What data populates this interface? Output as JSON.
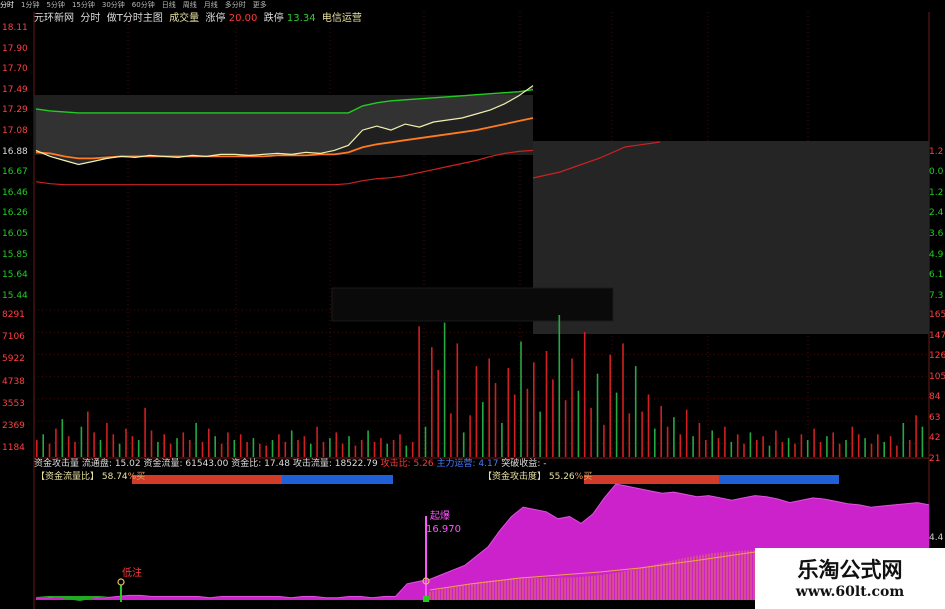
{
  "toolbar": {
    "tabs": [
      "分时",
      "1分钟",
      "5分钟",
      "15分钟",
      "30分钟",
      "60分钟",
      "日线",
      "周线",
      "月线",
      "多分时",
      "更多"
    ]
  },
  "header": {
    "stock_name": "元环新网",
    "view_label": "分时",
    "formula_label": "做T分时主图",
    "volume_label": "成交量",
    "limit_up_label": "涨停",
    "limit_up_value": "20.00",
    "limit_down_label": "跌停",
    "limit_down_value": "13.34",
    "sector_label": "电信运营"
  },
  "price_axis": {
    "left": [
      "18.11",
      "17.90",
      "17.70",
      "17.49",
      "17.29",
      "17.08",
      "16.88",
      "16.67",
      "16.46",
      "16.26",
      "16.05",
      "15.85",
      "15.64",
      "15.44"
    ],
    "right": [
      "",
      "",
      "",
      "",
      "",
      "",
      "1.2",
      "0.0",
      "1.2",
      "2.4",
      "3.6",
      "4.9",
      "6.1",
      "7.3"
    ]
  },
  "volume_axis": {
    "left": [
      "8291",
      "7106",
      "5922",
      "4738",
      "3553",
      "2369",
      "1184"
    ],
    "right": [
      "165",
      "147",
      "126",
      "105",
      "84",
      "63",
      "42",
      "21"
    ]
  },
  "indicator": {
    "name": "资金攻击量",
    "flow_label": "流通盘",
    "flow_value": "15.02",
    "fund_flow_label": "资金流量",
    "fund_flow_value": "61543.00",
    "fund_ratio_label": "资金比",
    "fund_ratio_value": "17.48",
    "attack_flow_label": "攻击流量",
    "attack_flow_value": "18522.79",
    "attack_ratio_label": "攻击比",
    "attack_ratio_value": "5.26",
    "extra_label": "主力运营",
    "extra_value": "4.17",
    "breakout_label": "突破收益",
    "breakout_value": "-",
    "ratio_bar_label": "【资金流量比】",
    "ratio_bar_value": "58.74",
    "ratio_bar_side": "%买",
    "attack_bar_label": "【资金攻击度】",
    "attack_bar_value": "55.26",
    "attack_bar_side": "%买",
    "sig1_label": "低注",
    "sig2_label": "起爆",
    "sig2_value": "16.970",
    "right_tick": "4.4"
  },
  "watermark": {
    "title": "乐淘公式网",
    "url": "www.60lt.com"
  },
  "colors": {
    "price_line": "#f0f0b0",
    "upper_band": "#22cc22",
    "lower_band": "#cc2222",
    "avg_line": "#ff7a20",
    "magenta": "#cc22cc",
    "bar_red": "#d23a2a",
    "bar_blue": "#1f5fd8"
  },
  "chart_data": [
    {
      "type": "line",
      "series": [
        {
          "values": [
            16.9,
            16.84,
            16.8,
            16.76,
            16.79,
            16.82,
            16.84,
            16.83,
            16.85,
            16.84,
            16.83,
            16.85,
            16.84,
            16.86,
            16.86,
            16.85,
            16.86,
            16.87,
            16.86,
            16.88,
            16.87,
            16.9,
            16.95,
            17.1,
            17.14,
            17.1,
            17.16,
            17.13,
            17.18,
            17.2,
            17.22,
            17.26,
            17.3,
            17.36,
            17.44,
            17.54
          ]
        },
        {
          "values": [
            17.31,
            17.29,
            17.28,
            17.27,
            17.27,
            17.27,
            17.27,
            17.27,
            17.27,
            17.27,
            17.27,
            17.27,
            17.27,
            17.27,
            17.27,
            17.27,
            17.27,
            17.27,
            17.27,
            17.27,
            17.27,
            17.27,
            17.27,
            17.34,
            17.37,
            17.39,
            17.4,
            17.41,
            17.42,
            17.43,
            17.44,
            17.45,
            17.46,
            17.47,
            17.48,
            17.5
          ]
        },
        {
          "values": [
            16.59,
            16.57,
            16.56,
            16.56,
            16.56,
            16.56,
            16.56,
            16.56,
            16.56,
            16.56,
            16.56,
            16.56,
            16.56,
            16.56,
            16.56,
            16.56,
            16.56,
            16.56,
            16.56,
            16.56,
            16.56,
            16.56,
            16.57,
            16.6,
            16.62,
            16.63,
            16.65,
            16.68,
            16.71,
            16.74,
            16.77,
            16.8,
            16.84,
            16.87,
            16.89,
            16.9
          ]
        },
        {
          "values": [
            16.88,
            16.87,
            16.84,
            16.82,
            16.82,
            16.83,
            16.84,
            16.84,
            16.84,
            16.84,
            16.84,
            16.84,
            16.84,
            16.84,
            16.84,
            16.84,
            16.84,
            16.85,
            16.85,
            16.85,
            16.86,
            16.86,
            16.88,
            16.93,
            16.96,
            16.98,
            17.0,
            17.02,
            17.04,
            17.06,
            17.08,
            17.1,
            17.13,
            17.16,
            17.19,
            17.22
          ]
        }
      ],
      "ylim": [
        15.44,
        18.11
      ]
    },
    {
      "type": "bar",
      "values": [
        900,
        1200,
        700,
        1500,
        2000,
        1100,
        800,
        1600,
        2400,
        1300,
        900,
        1800,
        1200,
        700,
        1500,
        1100,
        900,
        2600,
        1400,
        800,
        1200,
        700,
        1000,
        1300,
        900,
        1800,
        800,
        1500,
        1100,
        700,
        1300,
        900,
        1200,
        800,
        1000,
        700,
        600,
        900,
        1200,
        800,
        1400,
        900,
        1100,
        700,
        1600,
        800,
        1000,
        1300,
        700,
        1100,
        600,
        900,
        1400,
        800,
        1000,
        700,
        900,
        1200,
        600,
        800,
        6900,
        1600,
        5800,
        4600,
        7100,
        2300,
        6000,
        1300,
        2200,
        4800,
        2900,
        5200,
        3900,
        1800,
        4700,
        3300,
        6100,
        3600,
        5000,
        2400,
        5600,
        4100,
        7500,
        3000,
        5200,
        3500,
        6600,
        2600,
        4400,
        1700,
        5400,
        3400,
        6000,
        2300,
        4800,
        2400,
        3300,
        1500,
        2700,
        1600,
        2100,
        1200,
        2500,
        1100,
        1800,
        900,
        1400,
        1000,
        1600,
        800,
        1200,
        700,
        1300,
        900,
        1100,
        600,
        1400,
        800,
        1000,
        700,
        1200,
        900,
        1500,
        800,
        1100,
        1300,
        700,
        900,
        1600,
        1200,
        1000,
        700,
        1200,
        800,
        1100,
        600,
        1800,
        900,
        2200,
        1600
      ],
      "ylim": [
        0,
        8291
      ]
    },
    {
      "type": "area",
      "values": [
        2,
        2,
        3,
        3,
        2,
        2,
        2,
        3,
        4,
        4,
        3,
        3,
        3,
        3,
        3,
        2,
        3,
        3,
        3,
        3,
        3,
        3,
        2,
        3,
        3,
        2,
        2,
        3,
        3,
        2,
        3,
        3,
        14,
        16,
        18,
        22,
        26,
        30,
        38,
        46,
        60,
        72,
        80,
        78,
        76,
        70,
        72,
        66,
        74,
        88,
        100,
        98,
        96,
        94,
        92,
        93,
        91,
        89,
        90,
        88,
        86,
        88,
        90,
        89,
        87,
        84,
        86,
        88,
        87,
        85,
        83,
        82,
        80,
        81,
        82,
        83,
        84,
        82
      ],
      "ylim": [
        0,
        100
      ]
    }
  ]
}
